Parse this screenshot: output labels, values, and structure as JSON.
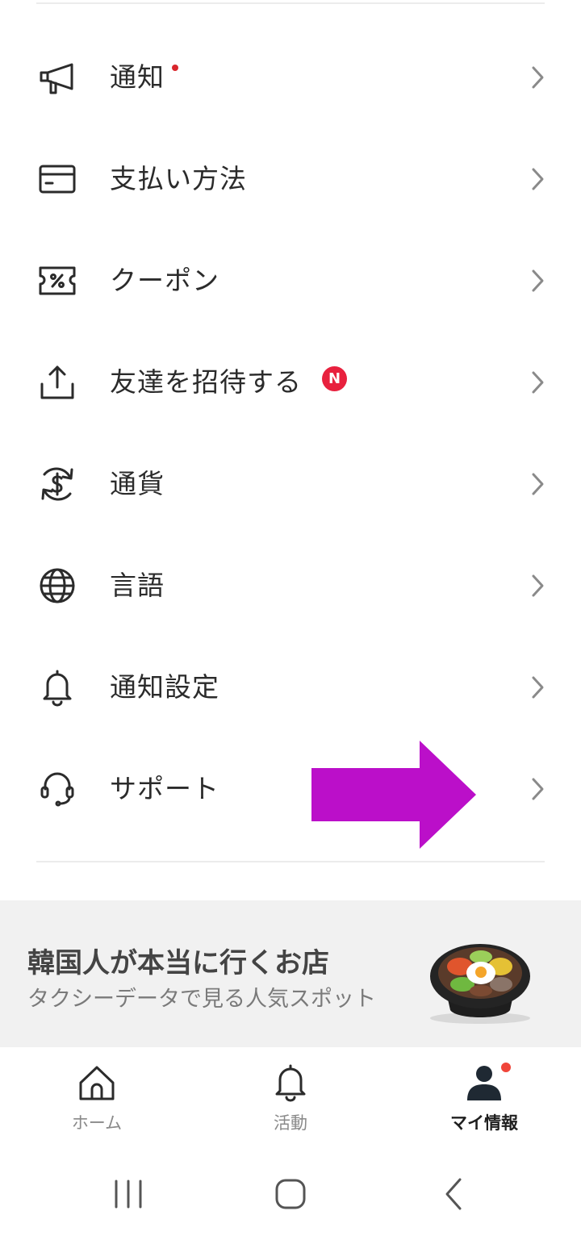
{
  "menu": {
    "items": [
      {
        "label": "通知",
        "icon": "megaphone-icon"
      },
      {
        "label": "支払い方法",
        "icon": "credit-card-icon"
      },
      {
        "label": "クーポン",
        "icon": "coupon-icon"
      },
      {
        "label": "友達を招待する",
        "icon": "share-icon",
        "badge": "N"
      },
      {
        "label": "通貨",
        "icon": "currency-exchange-icon"
      },
      {
        "label": "言語",
        "icon": "globe-icon"
      },
      {
        "label": "通知設定",
        "icon": "bell-icon"
      },
      {
        "label": "サポート",
        "icon": "headset-icon"
      }
    ]
  },
  "banner": {
    "title": "韓国人が本当に行くお店",
    "subtitle": "タクシーデータで見る人気スポット",
    "image": "bibimbap-bowl"
  },
  "tabs": [
    {
      "label": "ホーム",
      "icon": "home-icon",
      "active": false
    },
    {
      "label": "活動",
      "icon": "bell-icon",
      "active": false
    },
    {
      "label": "マイ情報",
      "icon": "person-icon",
      "active": true
    }
  ],
  "colors": {
    "notification_dot": "#d9262c",
    "new_badge": "#e8213e",
    "arrow": "#bb0fc9",
    "banner_bg": "#f1f1f1"
  }
}
